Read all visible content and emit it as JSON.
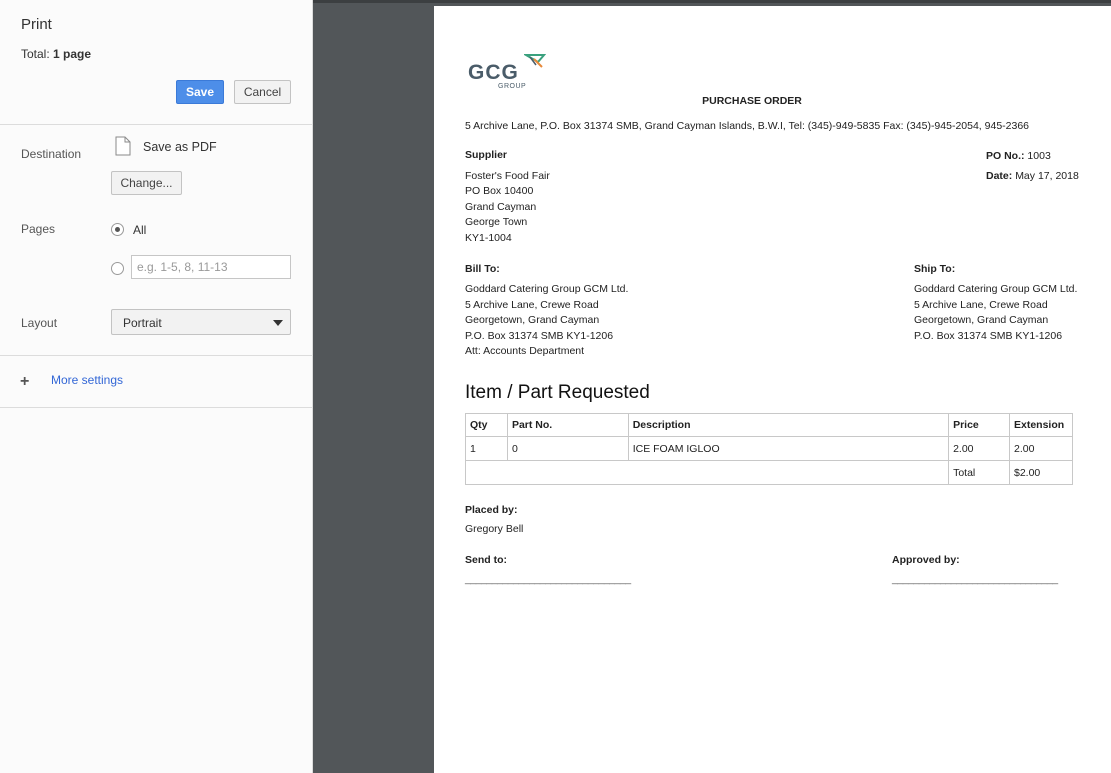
{
  "panel": {
    "title": "Print",
    "total_label": "Total: ",
    "total_value": "1 page",
    "save_label": "Save",
    "cancel_label": "Cancel",
    "destination_label": "Destination",
    "destination_value": "Save as PDF",
    "change_label": "Change...",
    "pages_label": "Pages",
    "pages_all_label": "All",
    "pages_custom_placeholder": "e.g. 1-5, 8, 11-13",
    "pages_selected": "All",
    "layout_label": "Layout",
    "layout_value": "Portrait",
    "more_settings_label": "More settings"
  },
  "document": {
    "logo_text": "GCG",
    "logo_sub": "GROUP",
    "title": "PURCHASE ORDER",
    "address": "5 Archive Lane, P.O. Box 31374 SMB, Grand Cayman Islands, B.W.I, Tel: (345)-949-5835 Fax: (345)-945-2054, 945-2366",
    "supplier": {
      "heading": "Supplier",
      "lines": [
        "Foster's Food Fair",
        "PO Box 10400",
        "Grand Cayman",
        "George Town",
        "KY1-1004"
      ]
    },
    "po_no_label": "PO No.:",
    "po_no_value": "1003",
    "date_label": "Date:",
    "date_value": "May 17, 2018",
    "bill_to": {
      "heading": "Bill To:",
      "lines": [
        "Goddard Catering Group GCM Ltd.",
        "5 Archive Lane, Crewe Road",
        "Georgetown, Grand Cayman",
        "P.O. Box 31374 SMB KY1-1206",
        "Att: Accounts Department"
      ]
    },
    "ship_to": {
      "heading": "Ship To:",
      "lines": [
        "Goddard Catering Group GCM Ltd.",
        "5 Archive Lane, Crewe Road",
        "Georgetown, Grand Cayman",
        "P.O. Box 31374 SMB KY1-1206"
      ]
    },
    "items_heading": "Item / Part Requested",
    "table": {
      "headers": [
        "Qty",
        "Part No.",
        "Description",
        "Price",
        "Extension"
      ],
      "rows": [
        [
          "1",
          "0",
          "ICE FOAM IGLOO",
          "2.00",
          "2.00"
        ]
      ],
      "total_label": "Total",
      "total_value": "$2.00"
    },
    "placed_by_label": "Placed by:",
    "placed_by_value": "Gregory Bell",
    "send_to_label": "Send to:",
    "approved_by_label": "Approved by:",
    "signature_line": "_______________________________"
  },
  "colors": {
    "save_button": "#4d8ee9",
    "link": "#3367d6",
    "preview_background": "#525659",
    "logo_gray": "#4a5c69",
    "logo_green": "#3aa17e",
    "logo_orange": "#e7893a"
  }
}
